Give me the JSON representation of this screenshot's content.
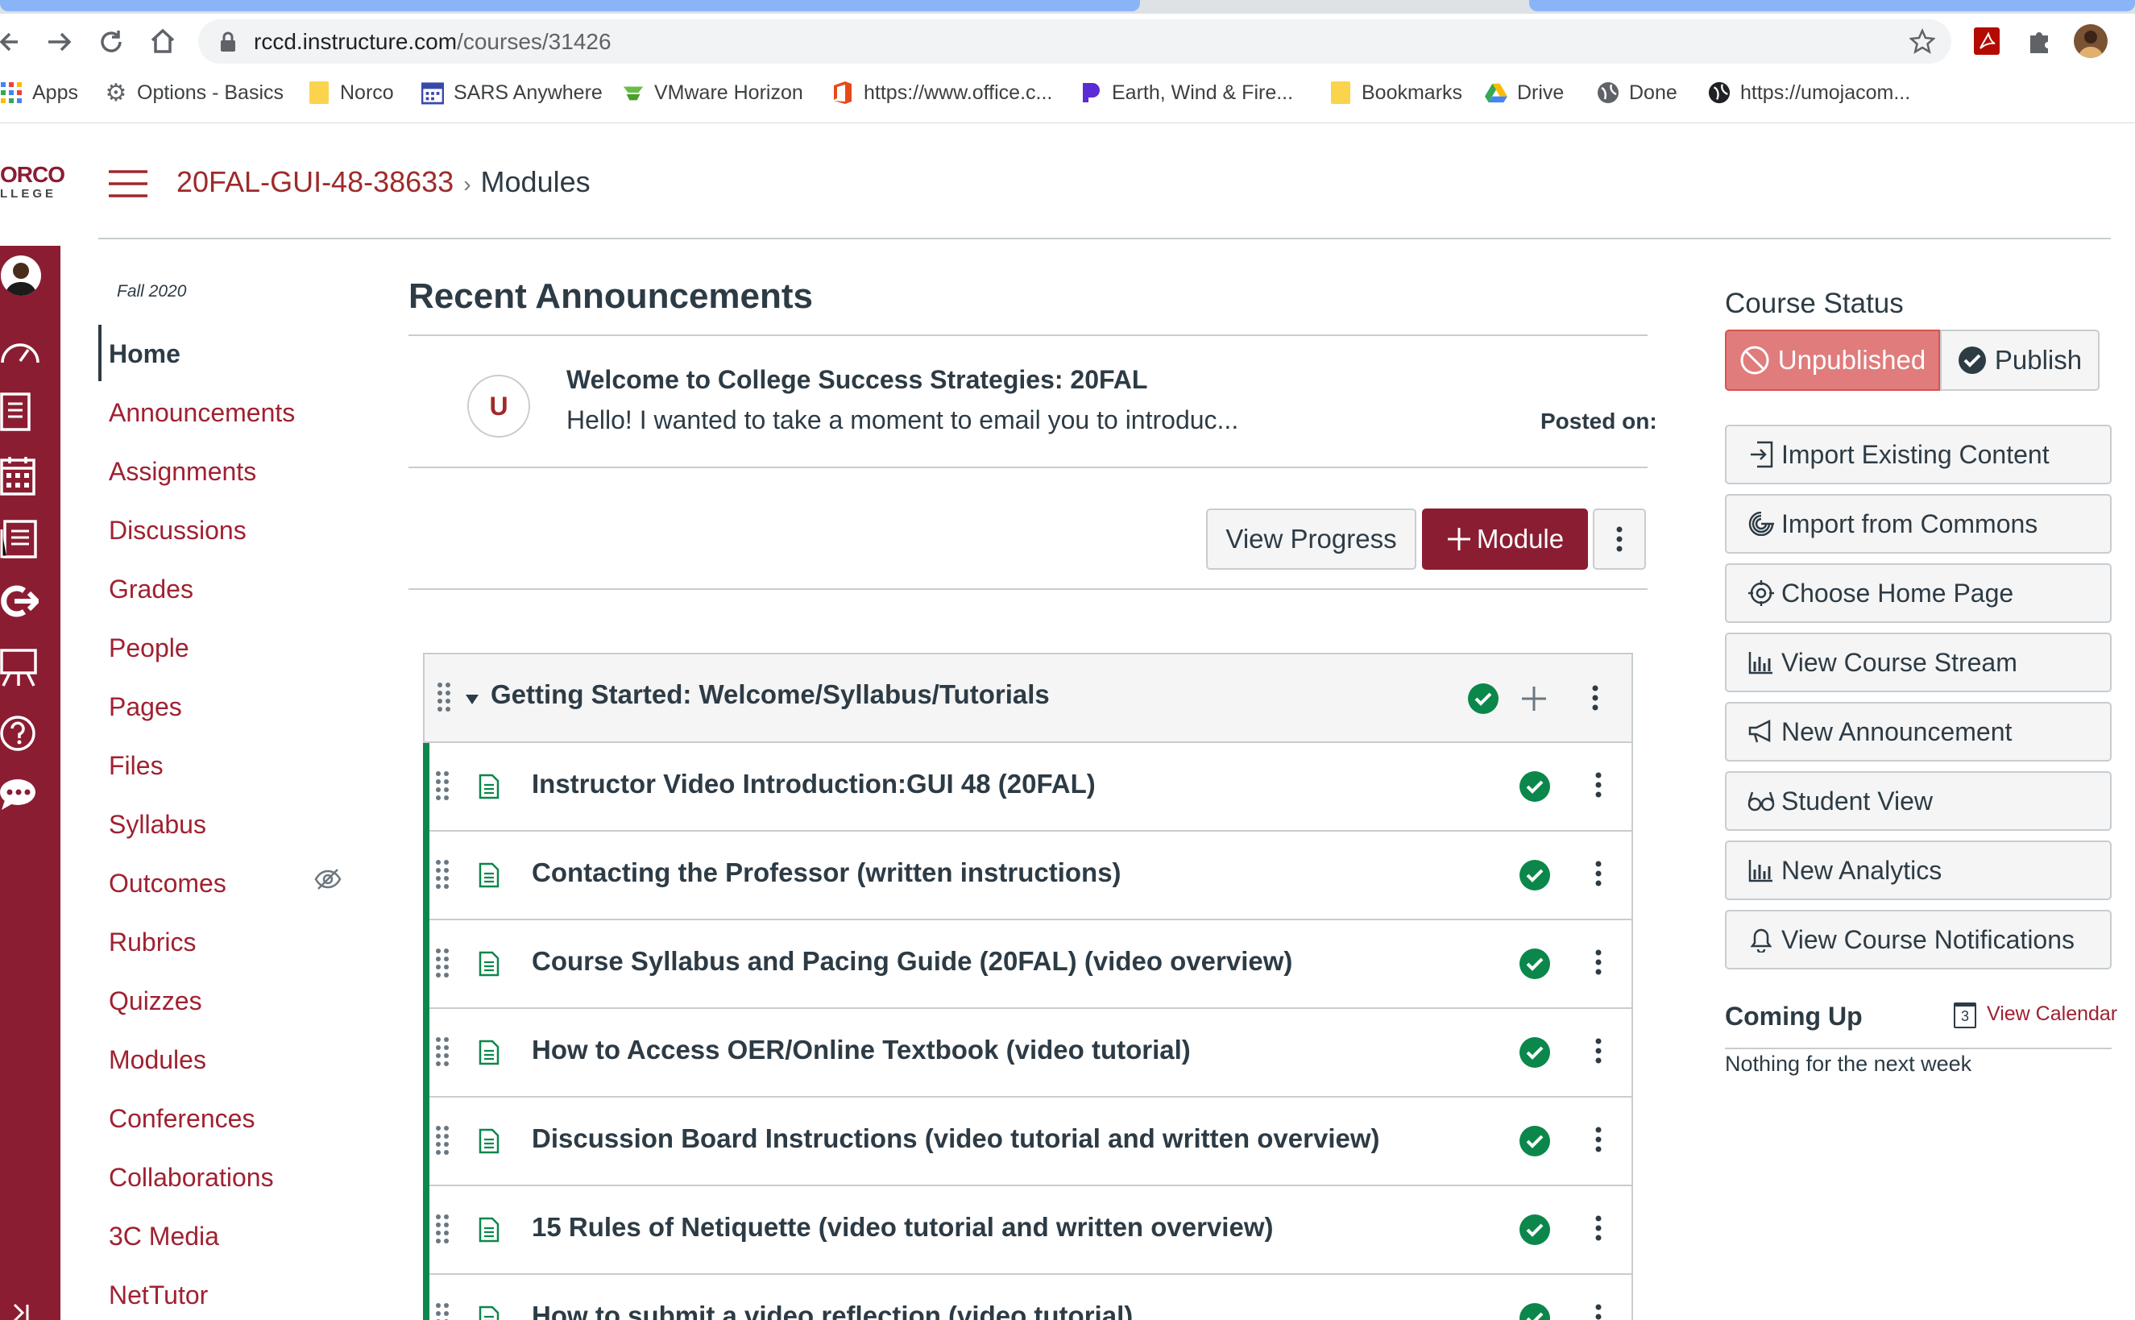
{
  "browser": {
    "url_domain": "rccd.instructure.com",
    "url_path": "/courses/31426",
    "bookmarks": [
      {
        "label": "Apps",
        "icon": "apps-grid-icon"
      },
      {
        "label": "Options - Basics",
        "icon": "gear-icon"
      },
      {
        "label": "Norco",
        "icon": "folder-icon"
      },
      {
        "label": "SARS Anywhere",
        "icon": "calendar-icon"
      },
      {
        "label": "VMware Horizon",
        "icon": "vmware-icon"
      },
      {
        "label": "https://www.office.c...",
        "icon": "office-icon"
      },
      {
        "label": "Earth, Wind & Fire...",
        "icon": "pandora-icon"
      },
      {
        "label": "Bookmarks",
        "icon": "folder-icon"
      },
      {
        "label": "Drive",
        "icon": "drive-icon"
      },
      {
        "label": "Done",
        "icon": "globe-icon"
      },
      {
        "label": "https://umojacom...",
        "icon": "globe-icon"
      }
    ]
  },
  "header": {
    "logo_line1": "ORCO",
    "logo_line2": "LLEGE",
    "course_code": "20FAL-GUI-48-38633",
    "separator": "›",
    "current_page": "Modules"
  },
  "course_nav": {
    "term": "Fall 2020",
    "items": [
      {
        "label": "Home",
        "active": true
      },
      {
        "label": "Announcements"
      },
      {
        "label": "Assignments"
      },
      {
        "label": "Discussions"
      },
      {
        "label": "Grades"
      },
      {
        "label": "People"
      },
      {
        "label": "Pages"
      },
      {
        "label": "Files"
      },
      {
        "label": "Syllabus"
      },
      {
        "label": "Outcomes",
        "hidden_icon": true
      },
      {
        "label": "Rubrics"
      },
      {
        "label": "Quizzes"
      },
      {
        "label": "Modules"
      },
      {
        "label": "Conferences"
      },
      {
        "label": "Collaborations"
      },
      {
        "label": "3C Media"
      },
      {
        "label": "NetTutor"
      }
    ]
  },
  "announcements": {
    "heading": "Recent Announcements",
    "avatar_letter": "U",
    "title": "Welcome to College Success Strategies: 20FAL",
    "snippet": "Hello!  I wanted to take a moment to email you to introduc...",
    "posted_label": "Posted on:"
  },
  "toolbar": {
    "view_progress": "View Progress",
    "add_module": "Module"
  },
  "module": {
    "title": "Getting Started: Welcome/Syllabus/Tutorials",
    "items": [
      "Instructor Video Introduction:GUI 48 (20FAL)",
      "Contacting the Professor (written instructions)",
      "Course Syllabus and Pacing Guide (20FAL) (video overview)",
      "How to Access OER/Online Textbook (video tutorial)",
      "Discussion Board Instructions (video tutorial and written overview)",
      "15 Rules of Netiquette (video tutorial and written overview)",
      "How to submit a video reflection (video tutorial)"
    ]
  },
  "sidebar": {
    "course_status": "Course Status",
    "unpublished": "Unpublished",
    "publish": "Publish",
    "actions": [
      {
        "label": "Import Existing Content",
        "icon": "import-icon"
      },
      {
        "label": "Import from Commons",
        "icon": "commons-icon"
      },
      {
        "label": "Choose Home Page",
        "icon": "target-icon"
      },
      {
        "label": "View Course Stream",
        "icon": "bar-chart-icon"
      },
      {
        "label": "New Announcement",
        "icon": "megaphone-icon"
      },
      {
        "label": "Student View",
        "icon": "glasses-icon"
      },
      {
        "label": "New Analytics",
        "icon": "bar-chart-icon"
      },
      {
        "label": "View Course Notifications",
        "icon": "bell-icon"
      }
    ],
    "coming_up": "Coming Up",
    "calendar_day": "3",
    "view_calendar": "View Calendar",
    "nothing": "Nothing for the next week"
  },
  "colors": {
    "brand": "#8b1d32",
    "link": "#a02131",
    "success": "#0b874b"
  }
}
